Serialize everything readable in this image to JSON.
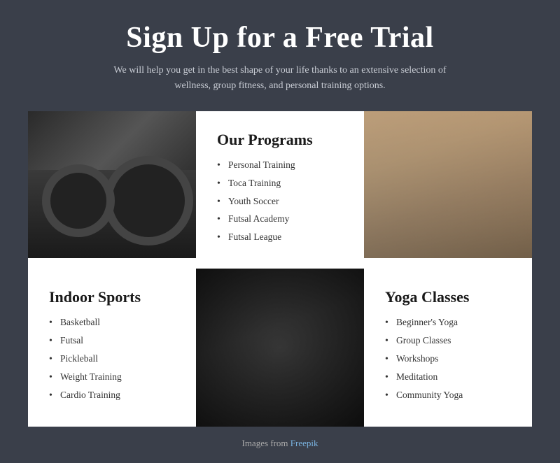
{
  "header": {
    "title": "Sign Up for a Free Trial",
    "subtitle": "We will help you get in the best shape of your life thanks to an extensive selection of wellness, group fitness, and personal training options."
  },
  "programs_section": {
    "title": "Our Programs",
    "items": [
      "Personal Training",
      "Toca Training",
      "Youth Soccer",
      "Futsal Academy",
      "Futsal League"
    ]
  },
  "indoor_sports_section": {
    "title": "Indoor Sports",
    "items": [
      "Basketball",
      "Futsal",
      "Pickleball",
      "Weight Training",
      "Cardio Training"
    ]
  },
  "yoga_classes_section": {
    "title": "Yoga Classes",
    "items": [
      "Beginner's Yoga",
      "Group Classes",
      "Workshops",
      "Meditation",
      "Community Yoga"
    ]
  },
  "footer": {
    "text": "Images from ",
    "link_label": "Freepik"
  }
}
